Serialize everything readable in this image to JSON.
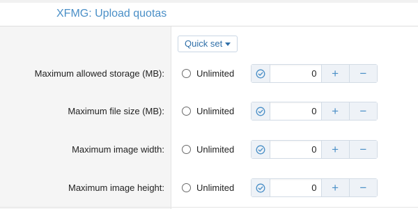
{
  "header": {
    "title": "XFMG: Upload quotas"
  },
  "quickset": {
    "label": "Quick set"
  },
  "rows": [
    {
      "label": "Maximum allowed storage (MB):",
      "unlimited_label": "Unlimited",
      "value": "0",
      "plus": "+",
      "minus": "−"
    },
    {
      "label": "Maximum file size (MB):",
      "unlimited_label": "Unlimited",
      "value": "0",
      "plus": "+",
      "minus": "−"
    },
    {
      "label": "Maximum image width:",
      "unlimited_label": "Unlimited",
      "value": "0",
      "plus": "+",
      "minus": "−"
    },
    {
      "label": "Maximum image height:",
      "unlimited_label": "Unlimited",
      "value": "0",
      "plus": "+",
      "minus": "−"
    }
  ],
  "colors": {
    "accent": "#4a8fc7",
    "label_bg": "#f5f5f5"
  }
}
